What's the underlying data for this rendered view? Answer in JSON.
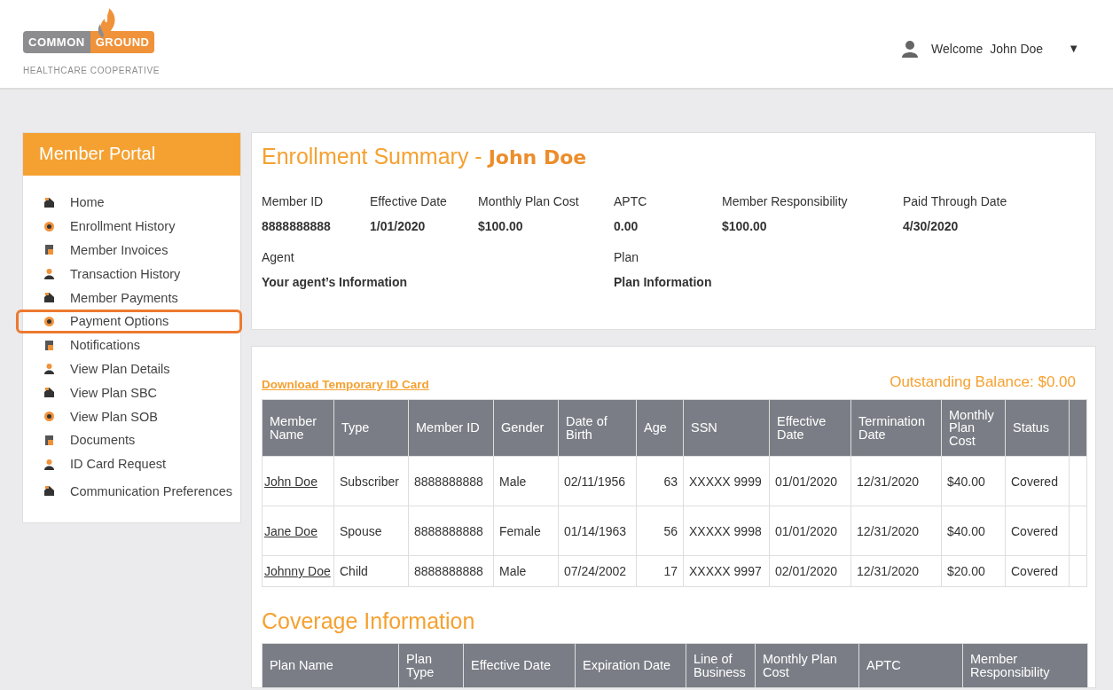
{
  "header": {
    "logo": {
      "word_1": "COMMON",
      "word_2": "GROUND",
      "tagline": "HEALTHCARE COOPERATIVE"
    },
    "welcome": "Welcome",
    "user_name": "John Doe",
    "menu_caret": "▼"
  },
  "sidebar": {
    "title": "Member Portal",
    "items": [
      {
        "label": "Home",
        "selected": false
      },
      {
        "label": "Enrollment History",
        "selected": false
      },
      {
        "label": "Member Invoices",
        "selected": false
      },
      {
        "label": "Transaction History",
        "selected": false
      },
      {
        "label": "Member Payments",
        "selected": false
      },
      {
        "label": "Payment Options",
        "selected": true
      },
      {
        "label": "Notifications",
        "selected": false
      },
      {
        "label": "View Plan Details",
        "selected": false
      },
      {
        "label": "View Plan SBC",
        "selected": false
      },
      {
        "label": "View Plan SOB",
        "selected": false
      },
      {
        "label": "Documents",
        "selected": false
      },
      {
        "label": "ID Card Request",
        "selected": false
      },
      {
        "label": "Communication Preferences",
        "selected": false
      }
    ]
  },
  "summary": {
    "title": "Enrollment Summary -",
    "name": "John Doe",
    "fields": [
      {
        "label": "Member ID",
        "value": "8888888888"
      },
      {
        "label": "Effective Date",
        "value": "1/01/2020"
      },
      {
        "label": "Monthly Plan Cost",
        "value": "$100.00"
      },
      {
        "label": "APTC",
        "value": "0.00"
      },
      {
        "label": "Member Responsibility",
        "value": "$100.00"
      },
      {
        "label": "Paid Through Date",
        "value": "4/30/2020"
      }
    ],
    "agent": {
      "label": "Agent",
      "value": "Your agent’s Information"
    },
    "plan": {
      "label": "Plan",
      "value": "Plan Information"
    }
  },
  "members": {
    "download_link": "Download Temporary ID Card",
    "outstanding_balance": "Outstanding Balance: $0.00",
    "columns": [
      "Member Name",
      "Type",
      "Member ID",
      "Gender",
      "Date of Birth",
      "Age",
      "SSN",
      "Effective Date",
      "Termination Date",
      "Monthly Plan Cost",
      "Status"
    ],
    "rows": [
      [
        "John Doe",
        "Subscriber",
        "8888888888",
        "Male",
        "02/11/1956",
        "63",
        "XXXXX 9999",
        "01/01/2020",
        "12/31/2020",
        "$40.00",
        "Covered"
      ],
      [
        "Jane Doe",
        "Spouse",
        "8888888888",
        "Female",
        "01/14/1963",
        "56",
        "XXXXX 9998",
        "01/01/2020",
        "12/31/2020",
        "$40.00",
        "Covered"
      ],
      [
        "Johnny Doe",
        "Child",
        "8888888888",
        "Male",
        "07/24/2002",
        "17",
        "XXXXX 9997",
        "02/01/2020",
        "12/31/2020",
        "$20.00",
        "Covered"
      ]
    ]
  },
  "coverage": {
    "title": "Coverage Information",
    "columns": [
      "Plan Name",
      "Plan Type",
      "Effective Date",
      "Expiration Date",
      "Line of Business",
      "Monthly Plan Cost",
      "APTC",
      "Member Responsibility"
    ]
  }
}
